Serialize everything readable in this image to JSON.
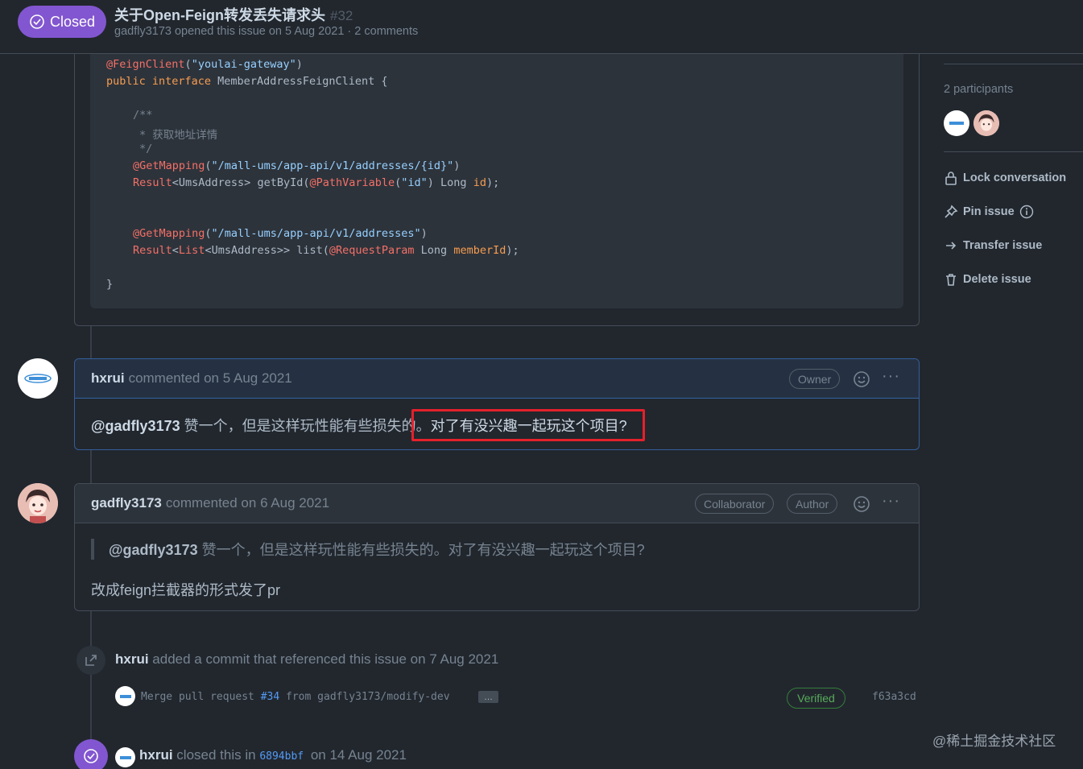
{
  "header": {
    "state": "Closed",
    "title": "关于Open-Feign转发丢失请求头",
    "number": "#32",
    "meta": "gadfly3173 opened this issue on 5 Aug 2021 · 2 comments"
  },
  "code": {
    "lines": [
      "@FeignClient(\"youlai-gateway\")",
      "public interface MemberAddressFeignClient {",
      "/**",
      "* 获取地址详情",
      "*/",
      "@GetMapping(\"/mall-ums/app-api/v1/addresses/{id}\")",
      "Result<UmsAddress> getById(@PathVariable(\"id\") Long id);",
      "@GetMapping(\"/mall-ums/app-api/v1/addresses\")",
      "Result<List<UmsAddress>> list(@RequestParam Long memberId);",
      "}"
    ]
  },
  "comments": [
    {
      "author": "hxrui",
      "action": "commented on 5 Aug 2021",
      "labels": [
        "Owner"
      ],
      "body_mention": "@gadfly3173",
      "body_text": " 赞一个，但是这样玩性能有些损失的。",
      "body_highlight": "对了有没兴趣一起玩这个项目?"
    },
    {
      "author": "gadfly3173",
      "action": "commented on 6 Aug 2021",
      "labels": [
        "Collaborator",
        "Author"
      ],
      "quote_mention": "@gadfly3173",
      "quote_text": " 赞一个，但是这样玩性能有些损失的。对了有没兴趣一起玩这个项目?",
      "body_text": "改成feign拦截器的形式发了pr"
    }
  ],
  "events": {
    "commit_event": {
      "author": "hxrui",
      "text": "added a commit that referenced this issue on 7 Aug 2021",
      "commit_msg_prefix": "Merge pull request ",
      "commit_pr": "#34",
      "commit_msg_suffix": " from gadfly3173/modify-dev",
      "ellipsis": "…",
      "verified": "Verified",
      "sha": "f63a3cd"
    },
    "closed_event": {
      "author": "hxrui",
      "text": "closed this in",
      "sha": "6894bbf",
      "date": "on 14 Aug 2021"
    }
  },
  "sidebar": {
    "participants_label": "2 participants",
    "actions": [
      "Lock conversation",
      "Pin issue",
      "Transfer issue",
      "Delete issue"
    ]
  },
  "watermark": "@稀土掘金技术社区",
  "colors": {
    "background": "#22272e",
    "closed_badge": "#8256d0",
    "highlight_box": "#e5202b",
    "owner_border": "#4184e4",
    "verified": "#57ab5a"
  }
}
